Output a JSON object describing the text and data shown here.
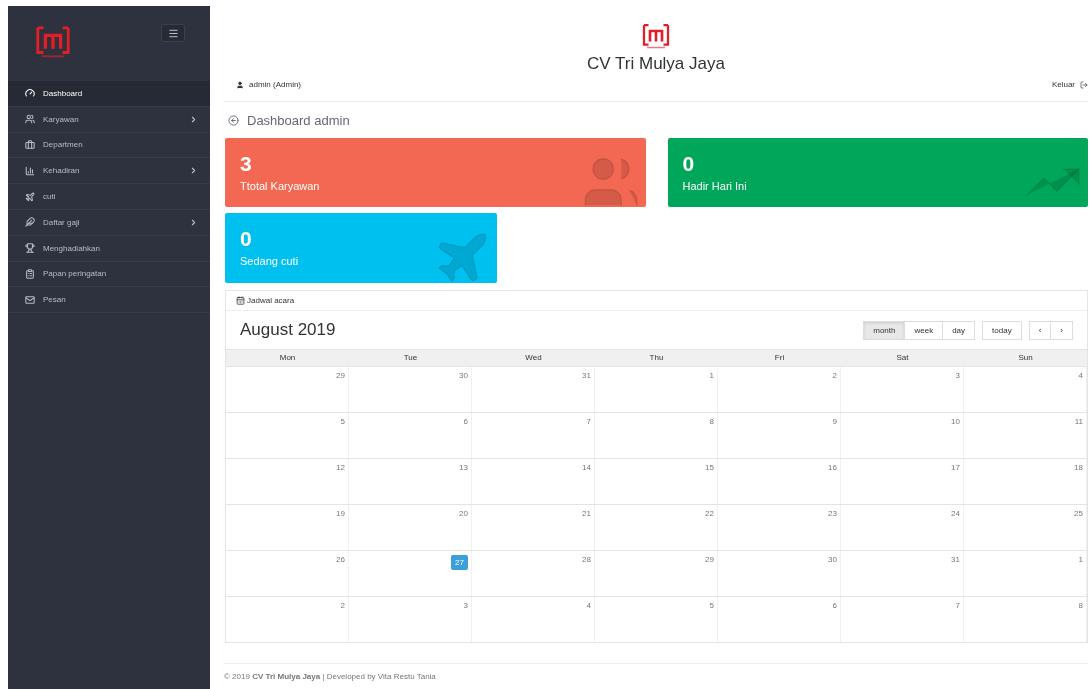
{
  "sidebar": {
    "items": [
      {
        "label": "Dashboard",
        "selected": true,
        "submenu": false
      },
      {
        "label": "Karyawan",
        "selected": false,
        "submenu": true
      },
      {
        "label": "Departmen",
        "selected": false,
        "submenu": false
      },
      {
        "label": "Kehadiran",
        "selected": false,
        "submenu": true
      },
      {
        "label": "cuti",
        "selected": false,
        "submenu": false
      },
      {
        "label": "Daftar gaji",
        "selected": false,
        "submenu": true
      },
      {
        "label": "Menghadiahkan",
        "selected": false,
        "submenu": false
      },
      {
        "label": "Papan peringatan",
        "selected": false,
        "submenu": false
      },
      {
        "label": "Pesan",
        "selected": false,
        "submenu": false
      }
    ]
  },
  "header": {
    "company": "CV Tri Mulya Jaya",
    "user": "admin (Admin)",
    "logout": "Keluar"
  },
  "page_title": "Dashboard admin",
  "stat_cards": [
    {
      "value": "3",
      "label": "Ttotal Karyawan",
      "color": "#f26852"
    },
    {
      "value": "0",
      "label": "Hadir Hari Ini",
      "color": "#00a65a"
    },
    {
      "value": "0",
      "label": "Sedang cuti",
      "color": "#00c0ef"
    }
  ],
  "calendar": {
    "panel_title": "Jadwal acara",
    "month": "August 2019",
    "views": [
      {
        "label": "month",
        "selected": true
      },
      {
        "label": "week",
        "selected": false
      },
      {
        "label": "day",
        "selected": false
      }
    ],
    "today_button": "today",
    "prev": "‹",
    "next": "›",
    "weekdays": [
      "Mon",
      "Tue",
      "Wed",
      "Thu",
      "Fri",
      "Sat",
      "Sun"
    ],
    "weeks": [
      [
        {
          "day": "29",
          "today": false
        },
        {
          "day": "30",
          "today": false
        },
        {
          "day": "31",
          "today": false
        },
        {
          "day": "1",
          "today": false
        },
        {
          "day": "2",
          "today": false
        },
        {
          "day": "3",
          "today": false
        },
        {
          "day": "4",
          "today": false
        }
      ],
      [
        {
          "day": "5",
          "today": false
        },
        {
          "day": "6",
          "today": false
        },
        {
          "day": "7",
          "today": false
        },
        {
          "day": "8",
          "today": false
        },
        {
          "day": "9",
          "today": false
        },
        {
          "day": "10",
          "today": false
        },
        {
          "day": "11",
          "today": false
        }
      ],
      [
        {
          "day": "12",
          "today": false
        },
        {
          "day": "13",
          "today": false
        },
        {
          "day": "14",
          "today": false
        },
        {
          "day": "15",
          "today": false
        },
        {
          "day": "16",
          "today": false
        },
        {
          "day": "17",
          "today": false
        },
        {
          "day": "18",
          "today": false
        }
      ],
      [
        {
          "day": "19",
          "today": false
        },
        {
          "day": "20",
          "today": false
        },
        {
          "day": "21",
          "today": false
        },
        {
          "day": "22",
          "today": false
        },
        {
          "day": "23",
          "today": false
        },
        {
          "day": "24",
          "today": false
        },
        {
          "day": "25",
          "today": false
        }
      ],
      [
        {
          "day": "26",
          "today": false
        },
        {
          "day": "27",
          "today": true
        },
        {
          "day": "28",
          "today": false
        },
        {
          "day": "29",
          "today": false
        },
        {
          "day": "30",
          "today": false
        },
        {
          "day": "31",
          "today": false
        },
        {
          "day": "1",
          "today": false
        }
      ],
      [
        {
          "day": "2",
          "today": false
        },
        {
          "day": "3",
          "today": false
        },
        {
          "day": "4",
          "today": false
        },
        {
          "day": "5",
          "today": false
        },
        {
          "day": "6",
          "today": false
        },
        {
          "day": "7",
          "today": false
        },
        {
          "day": "8",
          "today": false
        }
      ]
    ]
  },
  "footer": "© 2019 **CV Tri Mulya Jaya** | Developed by Vita Restu Tania"
}
